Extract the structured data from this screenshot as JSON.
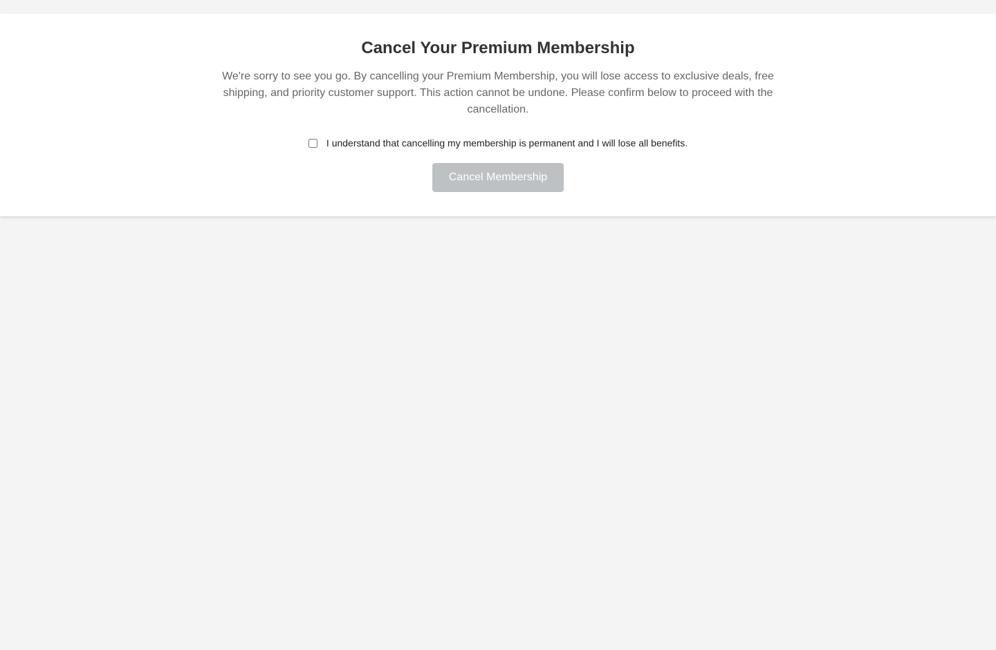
{
  "dialog": {
    "title": "Cancel Your Premium Membership",
    "description": "We're sorry to see you go. By cancelling your Premium Membership, you will lose access to exclusive deals, free shipping, and priority customer support. This action cannot be undone. Please confirm below to proceed with the cancellation.",
    "confirm_label": "I understand that cancelling my membership is permanent and I will lose all benefits.",
    "confirm_checked": false,
    "cancel_button_label": "Cancel Membership",
    "cancel_button_disabled": true
  },
  "colors": {
    "page_background": "#f4f4f4",
    "card_background": "#ffffff",
    "title_text": "#333333",
    "body_text": "#666666",
    "disabled_button": "#bdc1c4"
  }
}
